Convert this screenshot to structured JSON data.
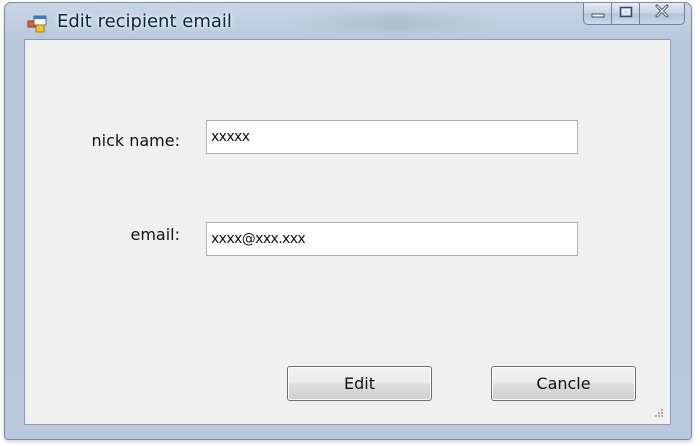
{
  "window": {
    "title": "Edit recipient email",
    "icon": "app-form-icon"
  },
  "caption": {
    "minimize_icon": "minimize-icon",
    "maximize_icon": "maximize-icon",
    "close_icon": "close-icon"
  },
  "form": {
    "nick_label": "nick name:",
    "nick_value": "xxxxx",
    "email_label": "email:",
    "email_value": "xxxx@xxx.xxx"
  },
  "buttons": {
    "edit_label": "Edit",
    "cancel_label": "Cancle"
  }
}
